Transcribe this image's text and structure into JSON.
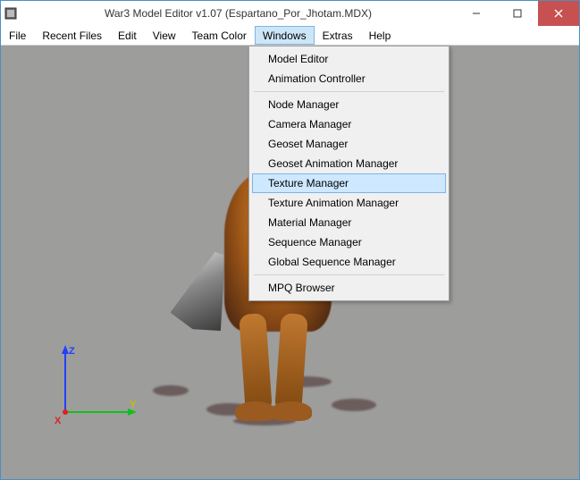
{
  "title": "War3 Model Editor v1.07 (Espartano_Por_Jhotam.MDX)",
  "menubar": {
    "file": "File",
    "recent": "Recent Files",
    "edit": "Edit",
    "view": "View",
    "teamcolor": "Team Color",
    "windows": "Windows",
    "extras": "Extras",
    "help": "Help"
  },
  "windows_menu": {
    "model_editor": "Model Editor",
    "animation_controller": "Animation Controller",
    "node_manager": "Node Manager",
    "camera_manager": "Camera Manager",
    "geoset_manager": "Geoset Manager",
    "geoset_anim_manager": "Geoset Animation Manager",
    "texture_manager": "Texture Manager",
    "texture_anim_manager": "Texture Animation Manager",
    "material_manager": "Material Manager",
    "sequence_manager": "Sequence Manager",
    "global_sequence_manager": "Global Sequence Manager",
    "mpq_browser": "MPQ Browser"
  },
  "axis": {
    "x": "X",
    "y": "Y",
    "z": "Z"
  }
}
